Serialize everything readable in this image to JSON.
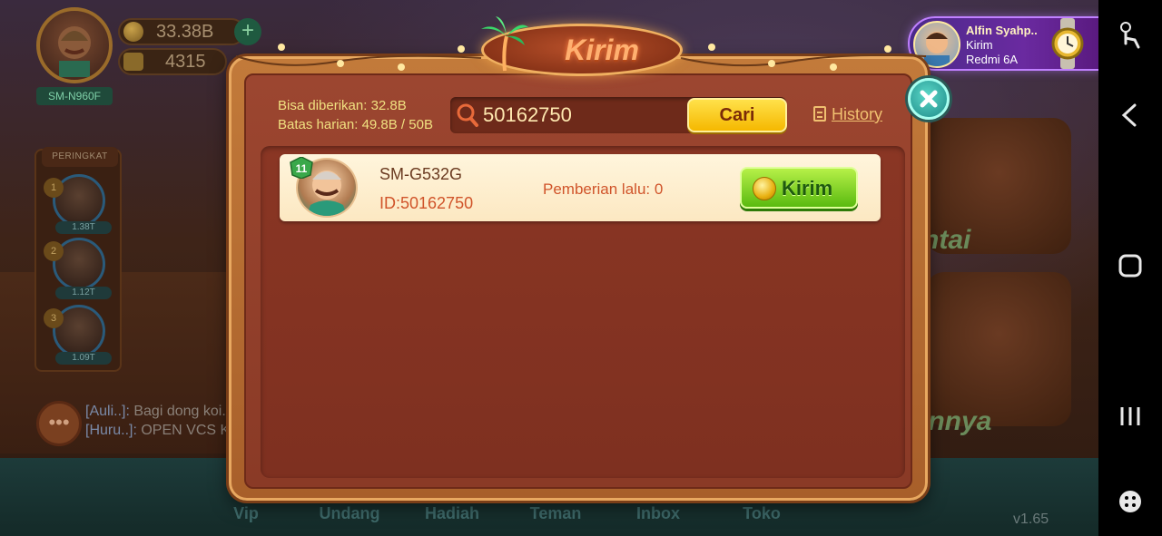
{
  "background": {
    "player": {
      "device_name": "SM-N960F"
    },
    "currency": {
      "coins": "33.38B",
      "tickets": "4315",
      "add_symbol": "+"
    },
    "ranking": {
      "title": "PERINGKAT",
      "entries": [
        {
          "rank": "1",
          "score": "1.38T"
        },
        {
          "rank": "2",
          "score": "1.12T"
        },
        {
          "rank": "3",
          "score": "1.09T"
        }
      ]
    },
    "chat": [
      {
        "user": "[Auli..]:",
        "message": "Bagi dong koi.."
      },
      {
        "user": "[Huru..]:",
        "message": "OPEN VCS K.."
      }
    ],
    "bottom_nav": [
      "Vip",
      "Undang",
      "Hadiah",
      "Teman",
      "Inbox",
      "Toko"
    ],
    "side_labels": {
      "top": "ntai",
      "bottom": "innya"
    },
    "version": "v1.65"
  },
  "notification": {
    "name": "Alfin Syahp..",
    "action": "Kirim",
    "device": "Redmi 6A"
  },
  "modal": {
    "title": "Kirim",
    "limits": {
      "giveable_label": "Bisa diberikan:",
      "giveable_value": "32.8B",
      "daily_label": "Batas harian:",
      "daily_value": "49.8B / 50B"
    },
    "search": {
      "value": "50162750",
      "button_label": "Cari"
    },
    "history_label": "History",
    "results": [
      {
        "level": "11",
        "name": "SM-G532G",
        "id": "ID:50162750",
        "last_given": "Pemberian lalu: 0",
        "action_label": "Kirim"
      }
    ]
  },
  "colors": {
    "modal_frame": "#c27a3a",
    "modal_inner": "#8a3a26",
    "cari_button": "#f5b800",
    "kirim_button": "#5aba10",
    "close_button": "#1f8a88"
  }
}
